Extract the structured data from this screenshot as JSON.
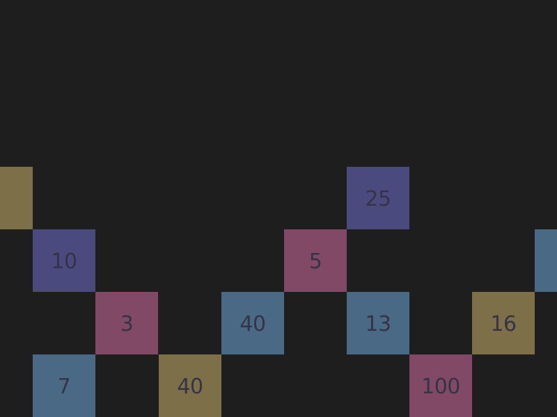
{
  "colors": {
    "background": "#1e1e1e",
    "tile_text": "#363346",
    "olive": "#7d6f47",
    "indigo": "#4a4a7e",
    "magenta": "#814966",
    "steel": "#4a6984"
  },
  "tiles": [
    {
      "value": "",
      "color": "olive"
    },
    {
      "value": "25",
      "color": "indigo"
    },
    {
      "value": "10",
      "color": "indigo"
    },
    {
      "value": "5",
      "color": "magenta"
    },
    {
      "value": "",
      "color": "steel"
    },
    {
      "value": "3",
      "color": "magenta"
    },
    {
      "value": "40",
      "color": "steel"
    },
    {
      "value": "13",
      "color": "steel"
    },
    {
      "value": "16",
      "color": "olive"
    },
    {
      "value": "7",
      "color": "steel"
    },
    {
      "value": "40",
      "color": "olive"
    },
    {
      "value": "100",
      "color": "magenta"
    }
  ]
}
